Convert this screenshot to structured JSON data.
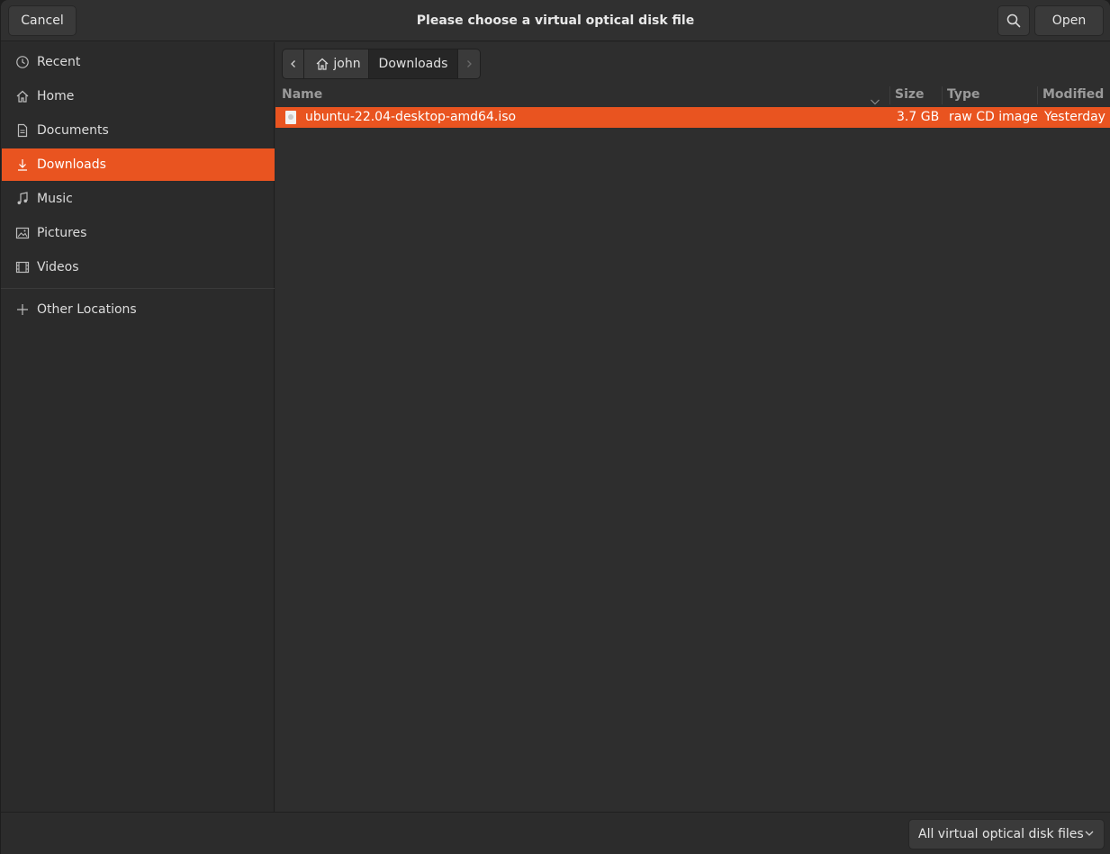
{
  "header": {
    "cancel_label": "Cancel",
    "title": "Please choose a virtual optical disk file",
    "open_label": "Open",
    "search_icon": "search-icon"
  },
  "sidebar": {
    "items": [
      {
        "label": "Recent",
        "icon": "recent-icon"
      },
      {
        "label": "Home",
        "icon": "home-icon"
      },
      {
        "label": "Documents",
        "icon": "documents-icon"
      },
      {
        "label": "Downloads",
        "icon": "downloads-icon",
        "active": true
      },
      {
        "label": "Music",
        "icon": "music-icon"
      },
      {
        "label": "Pictures",
        "icon": "pictures-icon"
      },
      {
        "label": "Videos",
        "icon": "videos-icon"
      },
      {
        "label": "Other Locations",
        "icon": "plus-icon"
      }
    ]
  },
  "pathbar": {
    "segments": [
      {
        "label": "john",
        "icon": "home-icon"
      },
      {
        "label": "Downloads"
      }
    ]
  },
  "filelist": {
    "columns": [
      "Name",
      "Size",
      "Type",
      "Modified"
    ],
    "rows": [
      {
        "name": "ubuntu-22.04-desktop-amd64.iso",
        "size": "3.7 GB",
        "type": "raw CD image",
        "modified": "Yesterday",
        "selected": true
      }
    ]
  },
  "footer": {
    "filter_label": "All virtual optical disk files"
  },
  "colors": {
    "accent": "#e95420",
    "background": "#2c2c2c"
  }
}
